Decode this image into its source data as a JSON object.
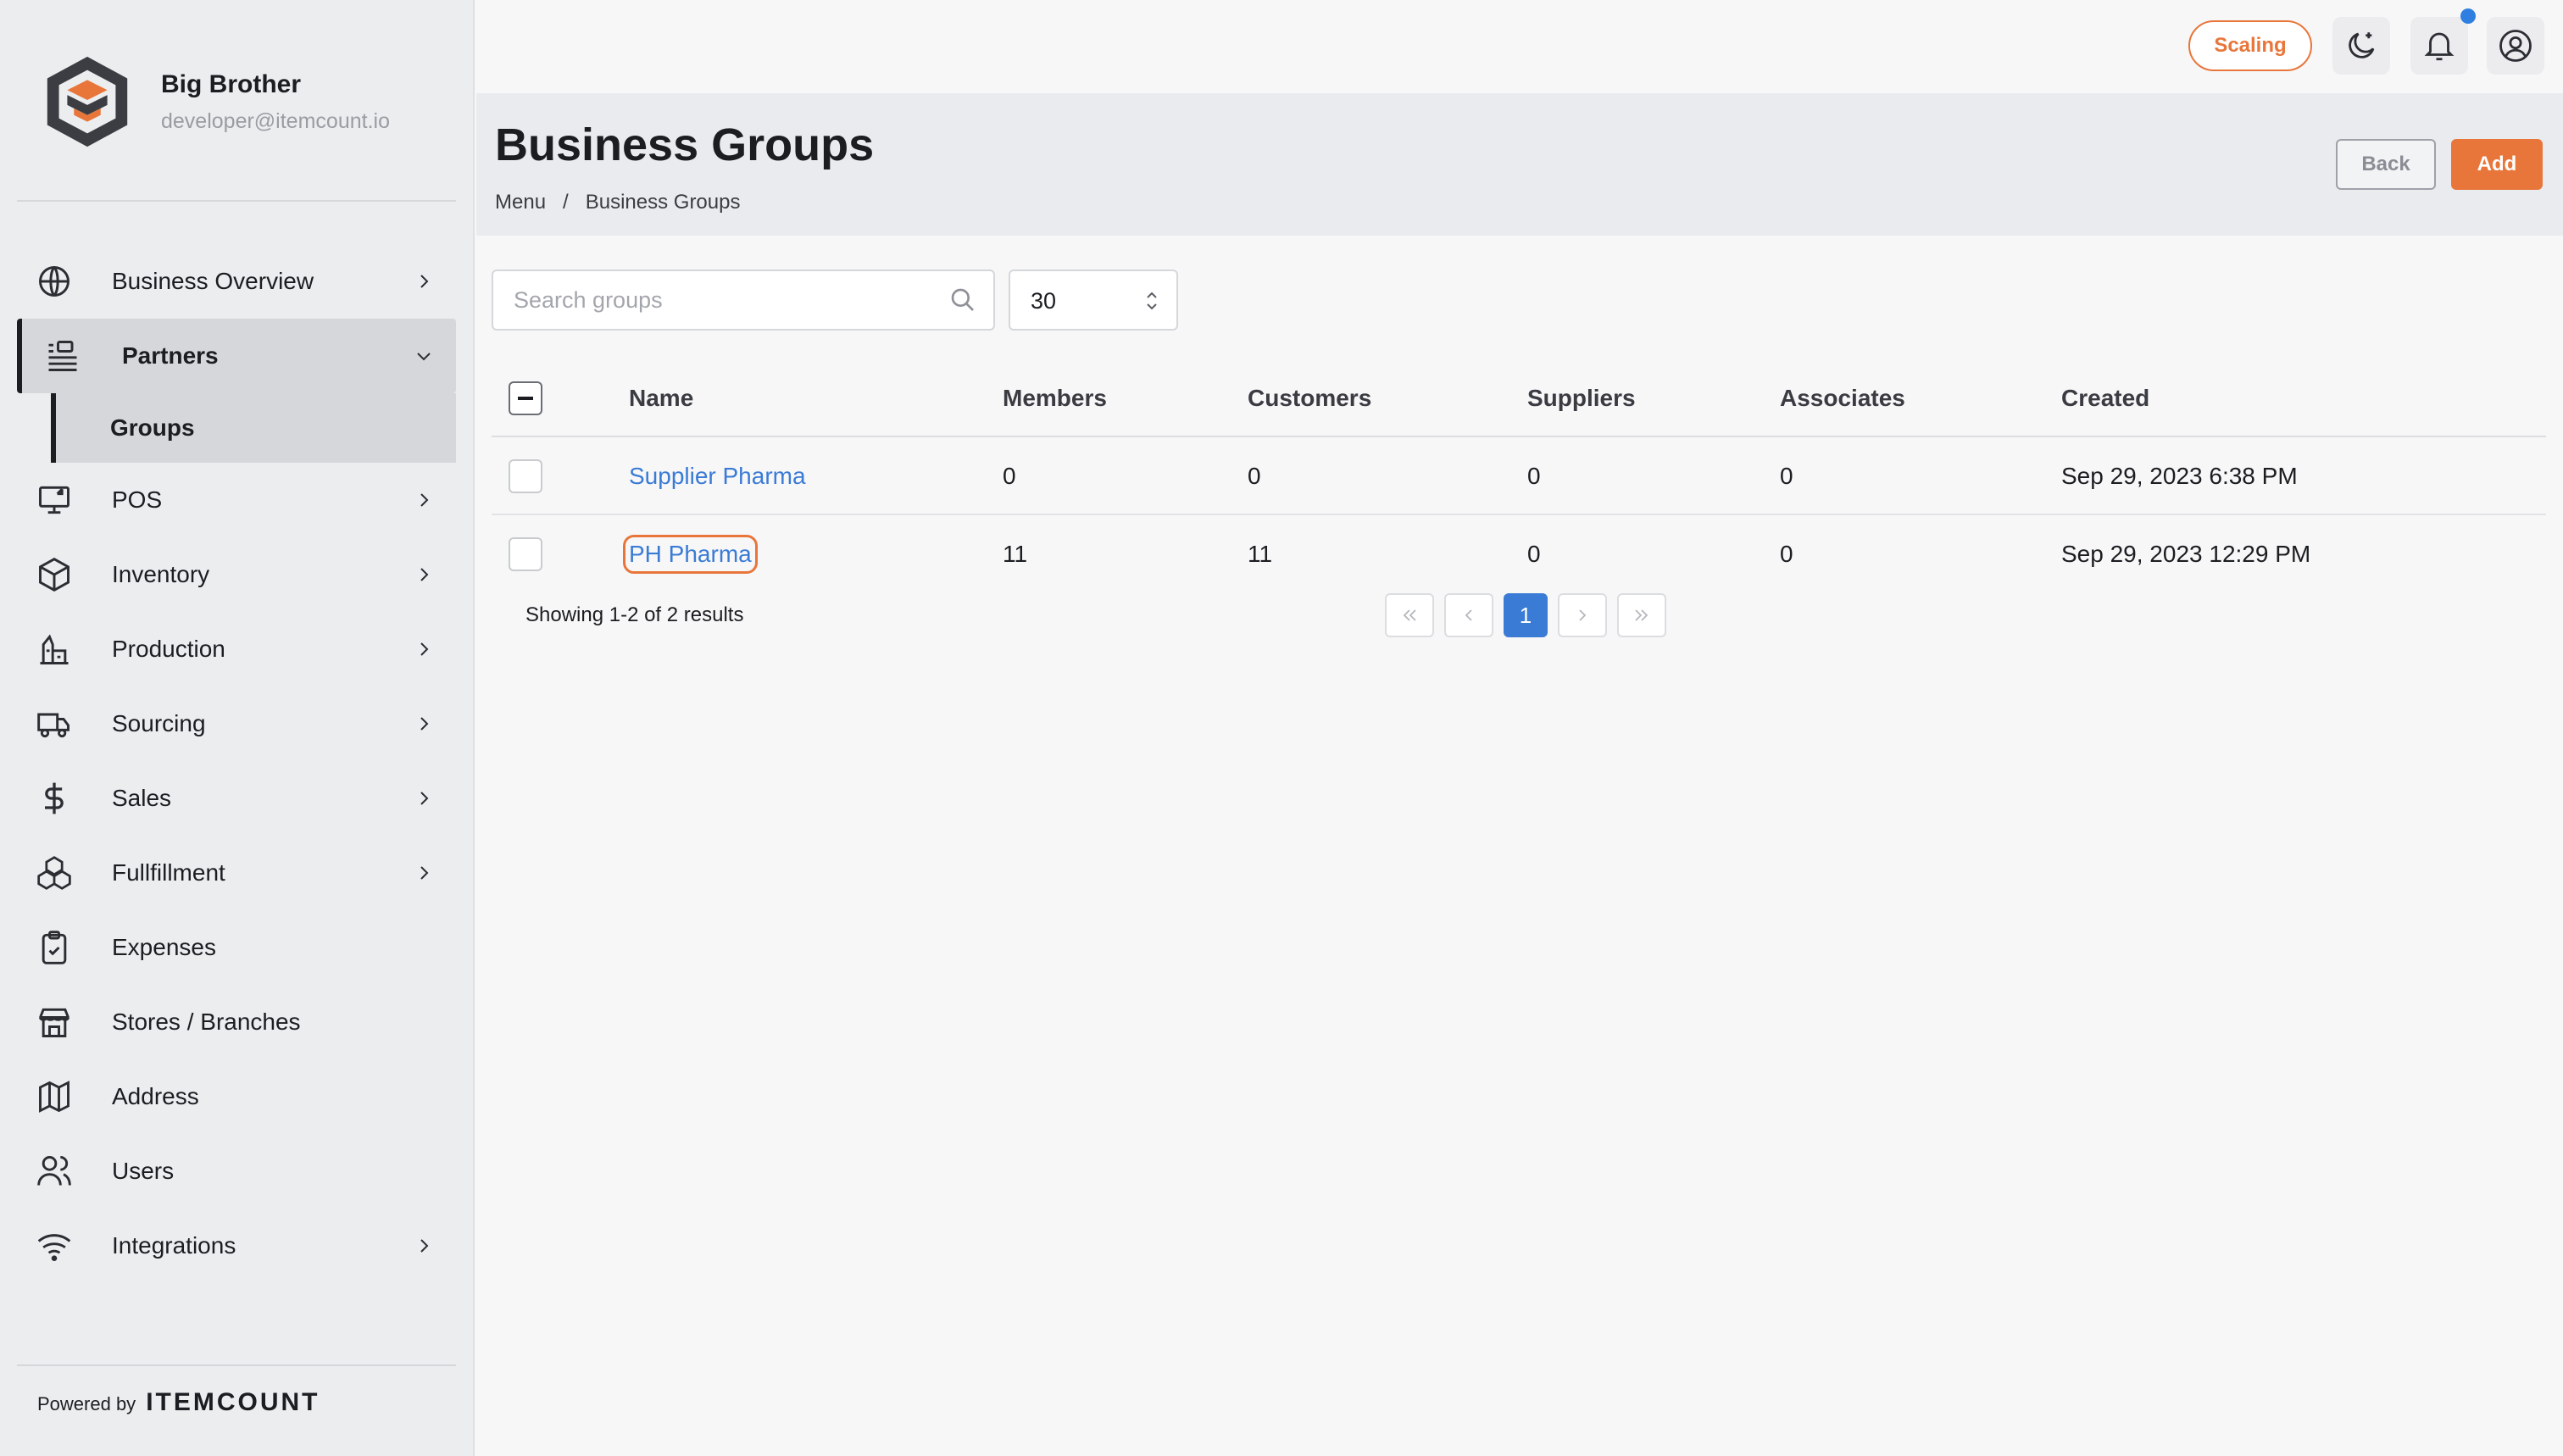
{
  "brand": {
    "name": "Big Brother",
    "email": "developer@itemcount.io"
  },
  "sidebar": {
    "items": [
      {
        "label": "Business Overview",
        "icon": "globe-icon",
        "has_chevron": true
      },
      {
        "label": "Partners",
        "icon": "partners-icon",
        "has_chevron": true,
        "expanded": true,
        "active": true
      },
      {
        "label": "POS",
        "icon": "monitor-icon",
        "has_chevron": true
      },
      {
        "label": "Inventory",
        "icon": "box-icon",
        "has_chevron": true
      },
      {
        "label": "Production",
        "icon": "factory-icon",
        "has_chevron": true
      },
      {
        "label": "Sourcing",
        "icon": "truck-icon",
        "has_chevron": true
      },
      {
        "label": "Sales",
        "icon": "dollar-icon",
        "has_chevron": true
      },
      {
        "label": "Fullfillment",
        "icon": "boxes-icon",
        "has_chevron": true
      },
      {
        "label": "Expenses",
        "icon": "clipboard-check-icon",
        "has_chevron": false
      },
      {
        "label": "Stores / Branches",
        "icon": "store-icon",
        "has_chevron": false
      },
      {
        "label": "Address",
        "icon": "map-icon",
        "has_chevron": false
      },
      {
        "label": "Users",
        "icon": "users-icon",
        "has_chevron": false
      },
      {
        "label": "Integrations",
        "icon": "wifi-icon",
        "has_chevron": true
      }
    ],
    "sub_item": {
      "label": "Groups",
      "active": true
    },
    "powered_by": "Powered by",
    "powered_brand": "ITEMCOUNT"
  },
  "topbar": {
    "plan_badge": "Scaling",
    "icons": [
      "moon-icon",
      "bell-icon",
      "user-circle-icon"
    ],
    "notification_dot": true
  },
  "header": {
    "title": "Business Groups",
    "breadcrumb": [
      "Menu",
      "/",
      "Business Groups"
    ],
    "back_label": "Back",
    "add_label": "Add"
  },
  "controls": {
    "search_placeholder": "Search groups",
    "search_value": "",
    "page_size": "30"
  },
  "table": {
    "columns": [
      "Name",
      "Members",
      "Customers",
      "Suppliers",
      "Associates",
      "Created"
    ],
    "rows": [
      {
        "name": "Supplier Pharma",
        "members": "0",
        "customers": "0",
        "suppliers": "0",
        "associates": "0",
        "created": "Sep 29, 2023 6:38 PM"
      },
      {
        "name": "PH Pharma",
        "members": "11",
        "customers": "11",
        "suppliers": "0",
        "associates": "0",
        "created": "Sep 29, 2023 12:29 PM"
      }
    ]
  },
  "pagination": {
    "summary": "Showing 1-2 of 2 results",
    "current_page": "1"
  },
  "colors": {
    "accent": "#e8763a",
    "link": "#3a7bd5",
    "sidebar_bg": "#ecedef",
    "notification_dot": "#2f7fe0"
  }
}
